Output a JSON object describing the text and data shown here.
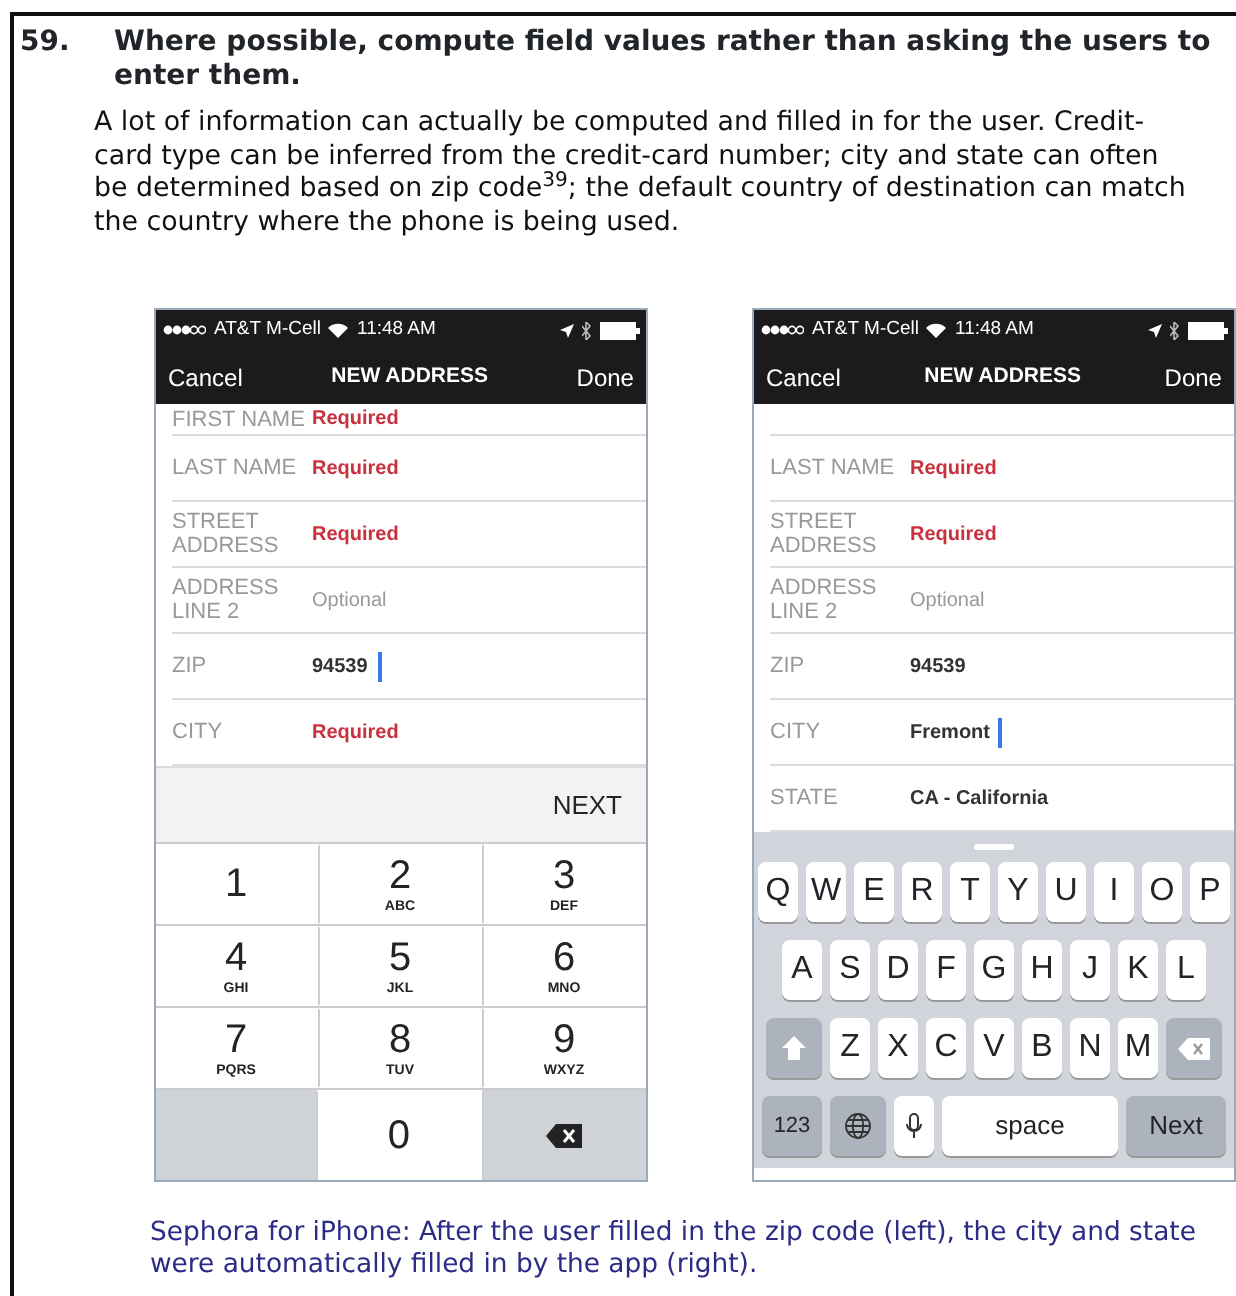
{
  "heading": {
    "number": "59.",
    "title": "Where possible, compute field values rather than asking the users to enter them."
  },
  "paragraph": "A lot of information can actually be computed and filled in for the user. Credit-card type can be inferred from the credit-card number; city and state can often be determined based on zip code$^{39}$; the default country of destination can match the country where the phone is being used.",
  "phones": [
    {
      "status_bar": {
        "carrier": "AT&T M-Cell",
        "time": "11:48 AM"
      },
      "nav": {
        "left": "Cancel",
        "title": "NEW ADDRESS",
        "right": "Done"
      },
      "fields": [
        {
          "label": "FIRST NAME",
          "placeholder": "Required",
          "required": true,
          "focused": false,
          "partial": true
        },
        {
          "label": "LAST NAME",
          "placeholder": "Required",
          "required": true,
          "focused": false
        },
        {
          "label": "STREET ADDRESS",
          "placeholder": "Required",
          "required": true,
          "focused": false
        },
        {
          "label": "ADDRESS LINE 2",
          "placeholder": "Optional",
          "required": false,
          "focused": false
        },
        {
          "label": "ZIP",
          "value": "94539",
          "focused": true
        },
        {
          "label": "CITY",
          "placeholder": "Required",
          "required": true,
          "focused": false
        }
      ],
      "keyboard": {
        "kind": "numeric",
        "toolbar": "NEXT",
        "rows": [
          [
            {
              "kind": "digit",
              "text": "1"
            },
            {
              "kind": "digit",
              "text": "2",
              "letters": "ABC"
            },
            {
              "kind": "digit",
              "text": "3",
              "letters": "DEF"
            }
          ],
          [
            {
              "kind": "digit",
              "text": "4",
              "letters": "GHI"
            },
            {
              "kind": "digit",
              "text": "5",
              "letters": "JKL"
            },
            {
              "kind": "digit",
              "text": "6",
              "letters": "MNO"
            }
          ],
          [
            {
              "kind": "digit",
              "text": "7",
              "letters": "PQRS"
            },
            {
              "kind": "digit",
              "text": "8",
              "letters": "TUV"
            },
            {
              "kind": "digit",
              "text": "9",
              "letters": "WXYZ"
            }
          ],
          [
            {
              "kind": "blank"
            },
            {
              "kind": "digit",
              "text": "0"
            },
            {
              "kind": "delete"
            }
          ]
        ]
      }
    },
    {
      "status_bar": {
        "carrier": "AT&T M-Cell",
        "time": "11:48 AM"
      },
      "nav": {
        "left": "Cancel",
        "title": "NEW ADDRESS",
        "right": "Done"
      },
      "fields": [
        {
          "label": "LAST NAME",
          "placeholder": "Required",
          "required": true,
          "focused": false
        },
        {
          "label": "STREET ADDRESS",
          "placeholder": "Required",
          "required": true,
          "focused": false
        },
        {
          "label": "ADDRESS LINE 2",
          "placeholder": "Optional",
          "required": false,
          "focused": false
        },
        {
          "label": "ZIP",
          "value": "94539",
          "focused": false
        },
        {
          "label": "CITY",
          "value": "Fremont",
          "focused": true
        },
        {
          "label": "STATE",
          "value": "CA - California",
          "focused": false
        }
      ],
      "keyboard": {
        "kind": "qwerty",
        "letter_rows": [
          [
            {
              "kind": "letter",
              "text": "Q"
            },
            {
              "kind": "letter",
              "text": "W"
            },
            {
              "kind": "letter",
              "text": "E"
            },
            {
              "kind": "letter",
              "text": "R"
            },
            {
              "kind": "letter",
              "text": "T"
            },
            {
              "kind": "letter",
              "text": "Y"
            },
            {
              "kind": "letter",
              "text": "U"
            },
            {
              "kind": "letter",
              "text": "I"
            },
            {
              "kind": "letter",
              "text": "O"
            },
            {
              "kind": "letter",
              "text": "P"
            }
          ],
          [
            {
              "kind": "letter",
              "text": "A"
            },
            {
              "kind": "letter",
              "text": "S"
            },
            {
              "kind": "letter",
              "text": "D"
            },
            {
              "kind": "letter",
              "text": "F"
            },
            {
              "kind": "letter",
              "text": "G"
            },
            {
              "kind": "letter",
              "text": "H"
            },
            {
              "kind": "letter",
              "text": "J"
            },
            {
              "kind": "letter",
              "text": "K"
            },
            {
              "kind": "letter",
              "text": "L"
            }
          ],
          [
            {
              "kind": "shift"
            },
            {
              "kind": "letter",
              "text": "Z"
            },
            {
              "kind": "letter",
              "text": "X"
            },
            {
              "kind": "letter",
              "text": "C"
            },
            {
              "kind": "letter",
              "text": "V"
            },
            {
              "kind": "letter",
              "text": "B"
            },
            {
              "kind": "letter",
              "text": "N"
            },
            {
              "kind": "letter",
              "text": "M"
            },
            {
              "kind": "delete"
            }
          ]
        ],
        "bottom_row": [
          {
            "kind": "mode",
            "text": "123"
          },
          {
            "kind": "globe"
          },
          {
            "kind": "mic"
          },
          {
            "kind": "space",
            "text": "space"
          },
          {
            "kind": "return",
            "text": "Next"
          }
        ]
      }
    }
  ],
  "caption": "Sephora for iPhone: After the user filled in the zip code (left), the city and state were automatically filled in by the app (right)."
}
